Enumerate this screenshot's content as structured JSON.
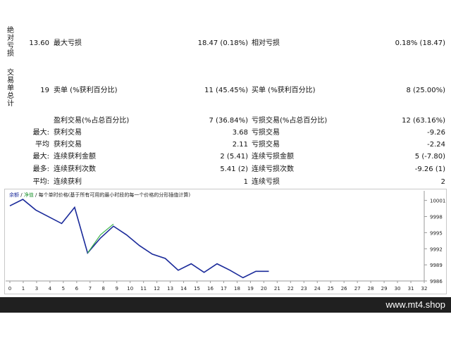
{
  "side_labels": {
    "absolute_drawdown": [
      "绝",
      "对",
      "亏",
      "损"
    ],
    "trade_summary": [
      "交",
      "易",
      "单",
      "总",
      "计"
    ]
  },
  "rows": {
    "row1": {
      "value1": "13.60",
      "label2": "最大亏损",
      "value2": "18.47 (0.18%)",
      "label3": "相对亏损",
      "value3": "0.18% (18.47)"
    },
    "row2": {
      "value1": "19",
      "label2": "卖单 (%获利百分比)",
      "value2": "11 (45.45%)",
      "label3": "买单 (%获利百分比)",
      "value3": "8 (25.00%)"
    },
    "row3": {
      "label2": "盈利交易(%占总百分比)",
      "value2": "7 (36.84%)",
      "label3": "亏损交易(%占总百分比)",
      "value3": "12 (63.16%)"
    },
    "row4": {
      "prefix": "最大:",
      "label2": "获利交易",
      "value2": "3.68",
      "label3": "亏损交易",
      "value3": "-9.26"
    },
    "row5": {
      "prefix": "平均",
      "label2": "获利交易",
      "value2": "2.11",
      "label3": "亏损交易",
      "value3": "-2.24"
    },
    "row6": {
      "prefix": "最大:",
      "label2": "连续获利金额",
      "value2": "2 (5.41)",
      "label3": "连续亏损金额",
      "value3": "5 (-7.80)"
    },
    "row7": {
      "prefix": "最多:",
      "label2": "连续获利次数",
      "value2": "5.41 (2)",
      "label3": "连续亏损次数",
      "value3": "-9.26 (1)"
    },
    "row8": {
      "prefix": "平均:",
      "label2": "连续获利",
      "value2": "1",
      "label3": "连续亏损",
      "value3": "2"
    }
  },
  "chart_legend": {
    "part1": "余额",
    "sep": " / ",
    "part2": "净值",
    "part3": " / 每个单时价格(基于所有可用的最小时段的每一个价格的分形插值计算)"
  },
  "footer": {
    "site": "www.mt4.shop"
  },
  "colors": {
    "balance": "#1a2a9a",
    "equity": "#3cb44b",
    "footer_bg": "#202020"
  },
  "chart_data": {
    "type": "line",
    "title": "",
    "x_ticks": [
      "0",
      "1",
      "3",
      "4",
      "5",
      "6",
      "7",
      "8",
      "9",
      "10",
      "11",
      "12",
      "13",
      "14",
      "15",
      "16",
      "17",
      "18",
      "19",
      "20",
      "21",
      "22",
      "23",
      "24",
      "25",
      "26",
      "27",
      "28",
      "29",
      "30",
      "31",
      "32"
    ],
    "y_ticks": [
      "10001",
      "9998",
      "9995",
      "9992",
      "9989",
      "9986"
    ],
    "xlim": [
      0,
      32
    ],
    "ylim": [
      9986,
      10002
    ],
    "series": [
      {
        "name": "余额",
        "x": [
          0,
          1,
          2,
          4,
          5,
          6,
          7,
          8,
          9,
          10,
          11,
          12,
          13,
          14,
          15,
          16,
          17,
          18,
          19,
          20
        ],
        "y": [
          10000.0,
          10001.2,
          9999.2,
          9996.7,
          9999.7,
          9991.2,
          9994.0,
          9996.2,
          9994.6,
          9992.6,
          9991.0,
          9990.2,
          9988.0,
          9989.2,
          9987.6,
          9989.2,
          9988.0,
          9986.6,
          9987.8,
          9987.8
        ]
      },
      {
        "name": "净值",
        "x": [
          6,
          7,
          8
        ],
        "y": [
          9991.2,
          9994.6,
          9996.6
        ]
      }
    ]
  }
}
